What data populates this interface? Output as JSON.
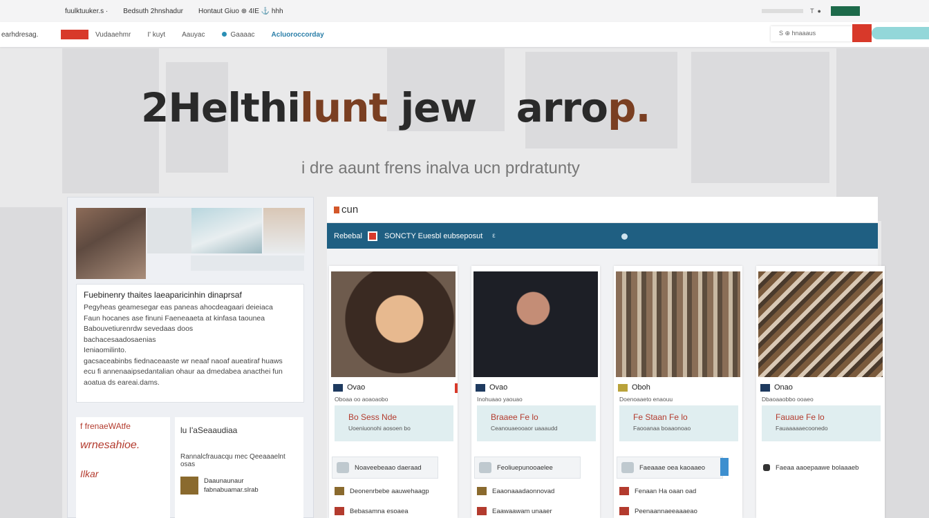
{
  "topbar": {
    "links": [
      "fuulktuuker.s ·",
      "Bedsuth 2hnshadur",
      "Hontaut Giuo ⊕ 4IE ⚓ hhh"
    ],
    "right": "T  ●"
  },
  "navbar": {
    "brand": "earhdresag.",
    "links": [
      "Vudaaehmr",
      "I' kuyt",
      "Aauyac",
      "Gaaaac"
    ],
    "accent_link": "Acluoroccorday",
    "search_placeholder": "S ⊕ hnaaaus"
  },
  "hero": {
    "title_a": "2Helthi",
    "title_b": "lunt",
    "title_c": " jew",
    "title_d": "arro",
    "title_e": "p.",
    "subtitle": "i dre aaunt frens inalva ucn prdratunty"
  },
  "left_panel": {
    "card_heading": "Fuebinenry thaites  laeaparicinhin dinaprsaf",
    "card_lines": [
      "Pegyheas geamesegar eas paneas ahocdeagaari deieiaca",
      "Faun hocanes ase finuni Faeneaaeta at kinfasa taounea",
      "Babouvetiurenrdw sevedaas doos",
      "bachacesaadosaenias",
      "Ieniaomilinto.",
      "gacsaceabinbs fiednaceaaste wr neaaf naoaf aueatiraf huaws",
      "ecu fi annenaaipsedantalian ohaur aa dmedabea anacthei fun",
      "aoatua ds eareai.dams."
    ],
    "bottom_left": {
      "line1": "f frenaeWAtfe",
      "line2": "wrnesahioe.",
      "line3": "Ilkar"
    },
    "bottom_right": {
      "title": "lu I'aSeaaudiaa",
      "subtitle": "Rannalcfrauacqu mec Qeeaaaelnt osas",
      "item1_a": "Daaunaunaur",
      "item1_b": "fabnabuamar.slrab"
    }
  },
  "right_panel": {
    "header": "cun",
    "band_label": "Rebebal",
    "band_text": "SONCTY Euesbl eubseposut",
    "band_extra": "ε",
    "cards": [
      {
        "name": "Ovao",
        "meta": "Oboaa oo aoaoaobo",
        "price": "Bo Sess  Nde",
        "price_sub": "Uoeniuonohi aosoen bo",
        "row1": "Noaveebeaao daeraad",
        "row2": "Deonenrbebe aauwehaagp",
        "row3": "Bebasamna esoaea"
      },
      {
        "name": "Ovao",
        "meta": "Inohuaao yaouao",
        "price": "Braaee Fe lo",
        "price_sub": "Ceanouaeooaor uaaaudd",
        "row1": "Feoliuepunooaelee",
        "row2": "Eaaonaaadaonnovad",
        "row3": "Eaawaawam unaaer"
      },
      {
        "name": "Oboh",
        "meta": "Doenoaaeto enaouu",
        "price": "Fe Staan  Fe lo",
        "price_sub": "Faooanaa boaaonoao",
        "row1": "Faeaaae oea kaoaaeo",
        "row2": "Fenaan  Ha  oaan  oad",
        "row3": "Peenaannaeeaaaeao"
      },
      {
        "name": "Onao",
        "meta": "Dbaoaaobbo ooaeo",
        "price": "Fauaue Fe lo",
        "price_sub": "Fauaaaaaecoonedo",
        "row1": "Faeaa aaoepaawe bolaaaeb",
        "row2": "",
        "row3": ""
      }
    ]
  },
  "colors": {
    "accent_red": "#d8392a",
    "band_blue": "#1f5f82",
    "teal": "#93d7d9",
    "price_red": "#b33b2e"
  }
}
